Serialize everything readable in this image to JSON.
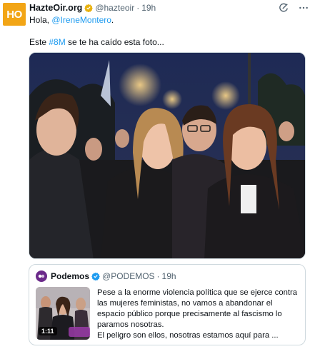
{
  "tweet": {
    "avatar_text": "HO",
    "author_name": "HazteOir.org",
    "author_handle": "@hazteoir",
    "separator": "·",
    "time": "19h",
    "line1_prefix": "Hola, ",
    "line1_mention": "@IreneMontero",
    "line1_suffix": ".",
    "line2_prefix": "Este ",
    "line2_hashtag": "#8M",
    "line2_suffix": " se te ha caído esta foto...",
    "verified_color": "#e8b10e",
    "link_color": "#1d9bf0"
  },
  "icons": {
    "grok": "grok-icon",
    "more": "more-icon"
  },
  "quote": {
    "author_name": "Podemos",
    "author_handle": "@PODEMOS",
    "separator": "·",
    "time": "19h",
    "video_duration": "1:11",
    "text_lines": [
      "Pese a la enorme violencia política que se ejerce contra",
      "las mujeres feministas, no vamos a abandonar el",
      "espacio público porque precisamente al fascismo lo",
      "paramos nosotras.",
      "El peligro son ellos, nosotras estamos aquí para ..."
    ],
    "verified_color": "#1d9bf0"
  }
}
